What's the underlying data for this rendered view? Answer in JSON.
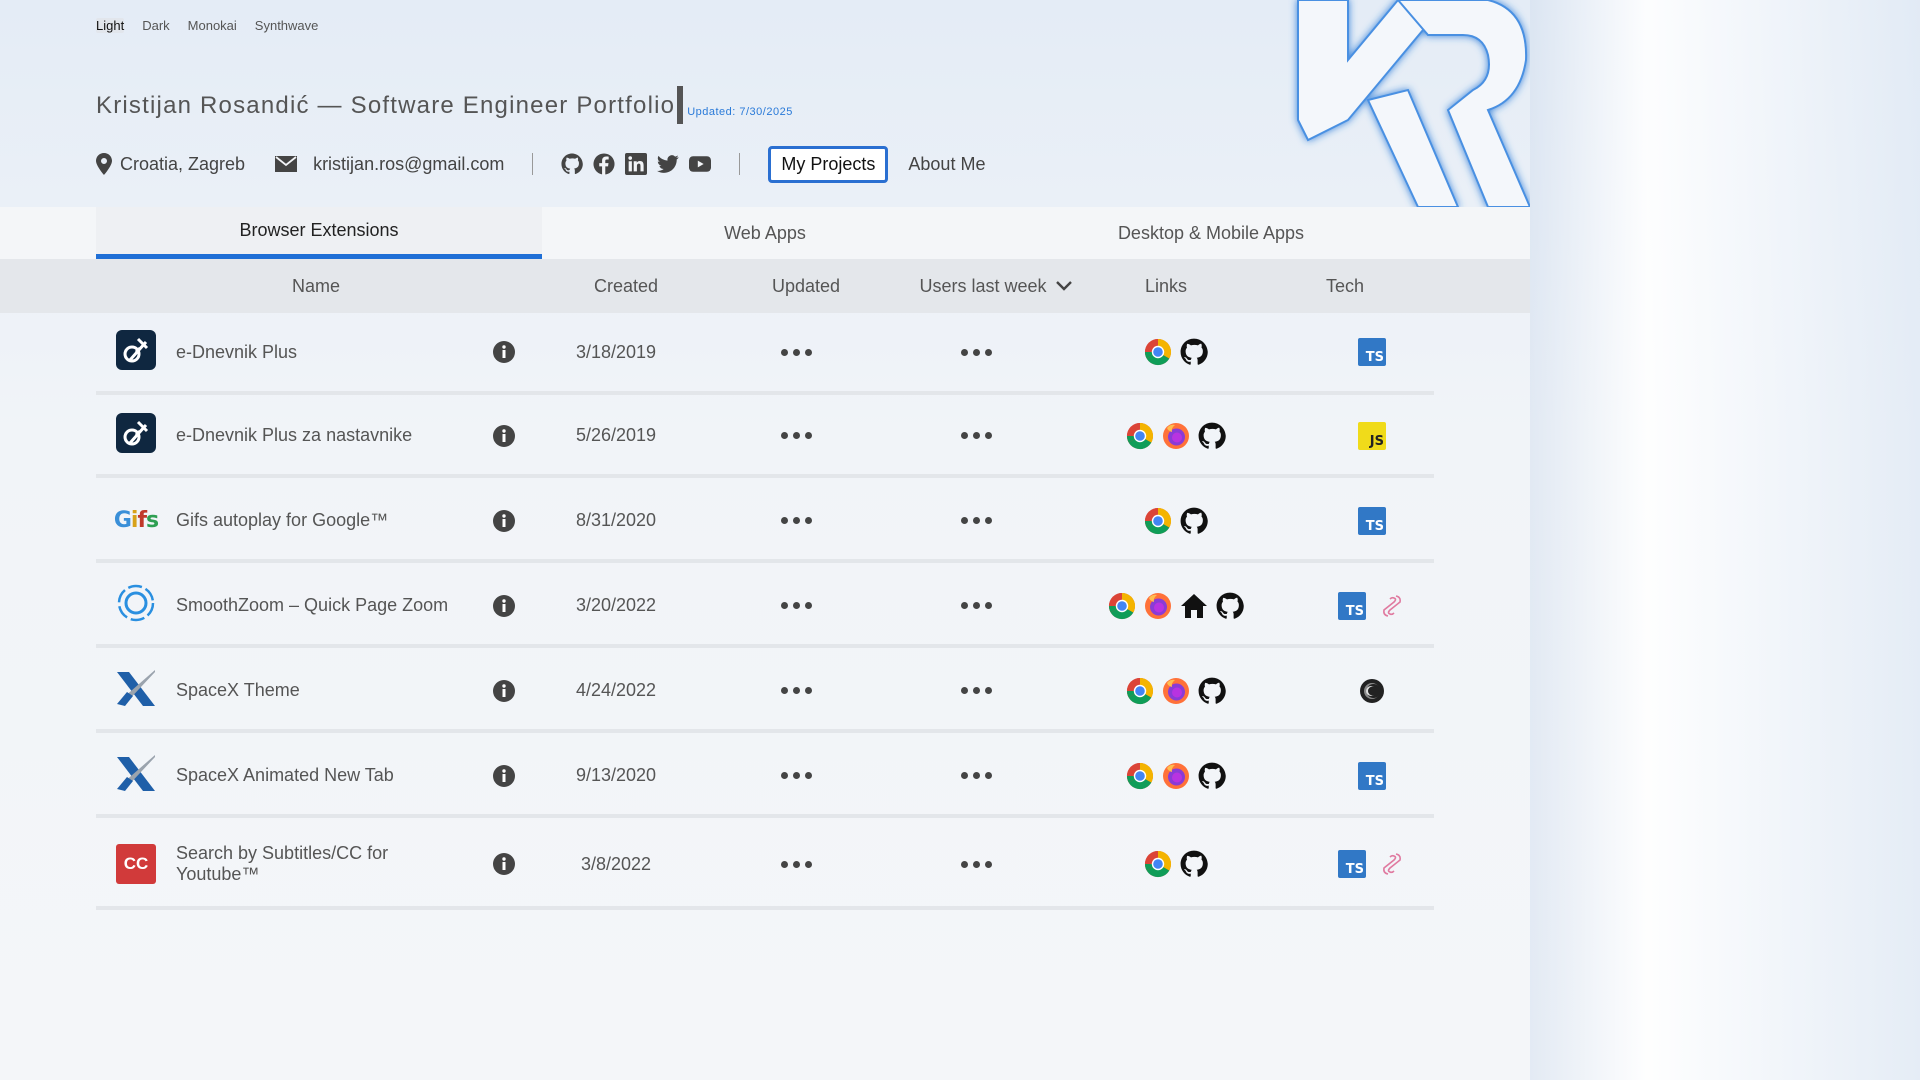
{
  "themes": [
    {
      "label": "Light",
      "active": true
    },
    {
      "label": "Dark",
      "active": false
    },
    {
      "label": "Monokai",
      "active": false
    },
    {
      "label": "Synthwave",
      "active": false
    }
  ],
  "header": {
    "title": "Kristijan Rosandić — Software Engineer Portfolio",
    "updated": "Updated: 7/30/2025",
    "location": "Croatia, Zagreb",
    "email": "kristijan.ros@gmail.com",
    "nav": {
      "projects": "My Projects",
      "about": "About Me"
    }
  },
  "tabs": [
    "Browser Extensions",
    "Web Apps",
    "Desktop & Mobile Apps"
  ],
  "columns": {
    "name": "Name",
    "created": "Created",
    "updated": "Updated",
    "users": "Users last week",
    "links": "Links",
    "tech": "Tech"
  },
  "rows": [
    {
      "name": "e-Dnevnik Plus",
      "created": "3/18/2019",
      "icon": "ednevnik-logo",
      "links": [
        "chrome",
        "github"
      ],
      "tech": [
        "ts"
      ]
    },
    {
      "name": "e-Dnevnik Plus za nastavnike",
      "created": "5/26/2019",
      "icon": "ednevnik-logo",
      "links": [
        "chrome",
        "firefox",
        "github"
      ],
      "tech": [
        "js"
      ]
    },
    {
      "name": "Gifs autoplay for Google™",
      "created": "8/31/2020",
      "icon": "gifs-logo",
      "links": [
        "chrome",
        "github"
      ],
      "tech": [
        "ts"
      ]
    },
    {
      "name": "SmoothZoom – Quick Page Zoom",
      "created": "3/20/2022",
      "icon": "smoothzoom-logo",
      "links": [
        "chrome",
        "firefox",
        "home",
        "github"
      ],
      "tech": [
        "ts",
        "svelte"
      ]
    },
    {
      "name": "SpaceX Theme",
      "created": "4/24/2022",
      "icon": "spacex-logo",
      "links": [
        "chrome",
        "firefox",
        "github"
      ],
      "tech": [
        "dark-reader"
      ]
    },
    {
      "name": "SpaceX Animated New Tab",
      "created": "9/13/2020",
      "icon": "spacex-logo",
      "links": [
        "chrome",
        "firefox",
        "github"
      ],
      "tech": [
        "ts"
      ]
    },
    {
      "name": "Search by Subtitles/CC for Youtube™",
      "created": "3/8/2022",
      "icon": "cc-logo",
      "icon_text": "CC",
      "links": [
        "chrome",
        "github"
      ],
      "tech": [
        "ts",
        "svelte"
      ]
    }
  ],
  "icon_texts": {
    "ts": "TS",
    "js": "JS",
    "gifs": "Gifs"
  },
  "colors": {
    "accent": "#1f6fd6",
    "updated": "#2a7ad8",
    "cc": "#d13a3a",
    "ednevnik": "#0f2740",
    "ts": "#3178c6",
    "js": "#f0db1a"
  }
}
